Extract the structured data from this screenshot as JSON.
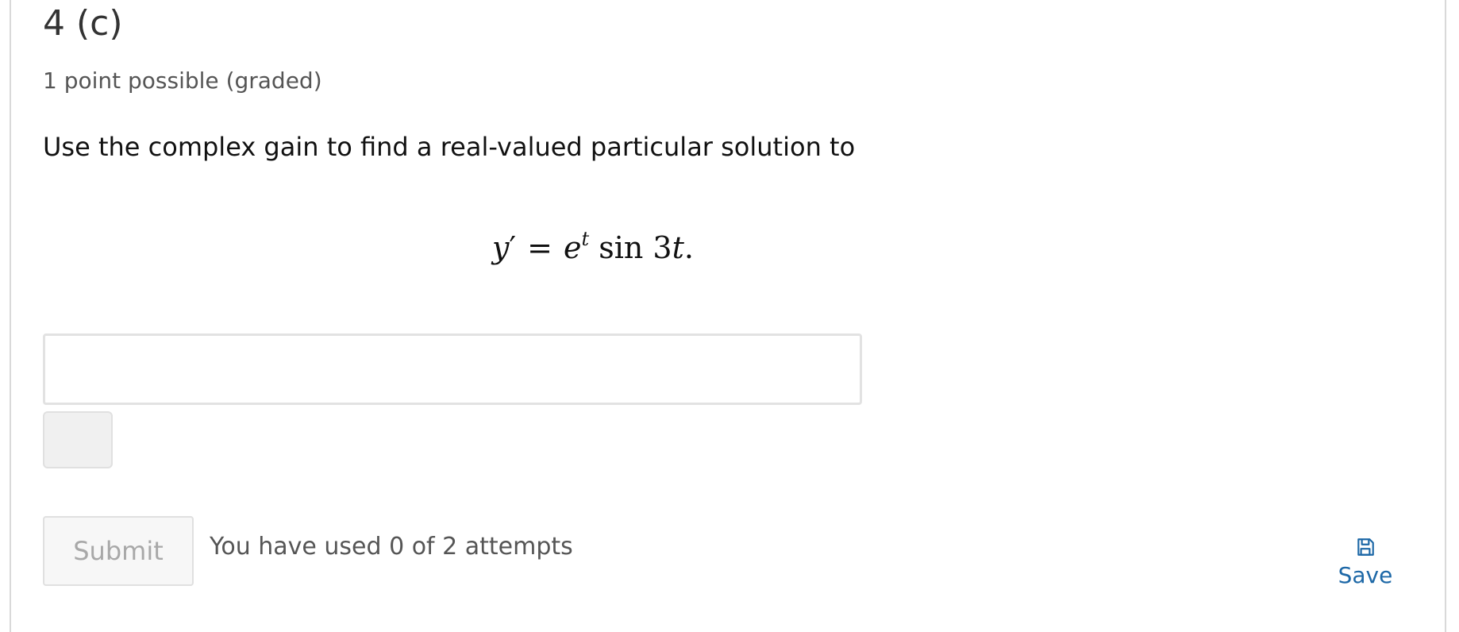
{
  "problem": {
    "title": "4 (c)",
    "points": "1 point possible (graded)",
    "prompt": "Use the complex gain to find a real-valued particular solution to",
    "equation": {
      "lhs": "y",
      "prime": "′",
      "equals": "=",
      "base": "e",
      "exponent": "t",
      "func": "sin 3",
      "var": "t",
      "end": "."
    }
  },
  "answer": {
    "value": "",
    "placeholder": ""
  },
  "actions": {
    "submit_label": "Submit",
    "attempts_text": "You have used 0 of 2 attempts",
    "save_label": "Save",
    "save_icon": "floppy-disk-icon"
  },
  "colors": {
    "link": "#1d68a7",
    "disabled_text": "#a8a8a8",
    "border": "#e2e2e2"
  }
}
